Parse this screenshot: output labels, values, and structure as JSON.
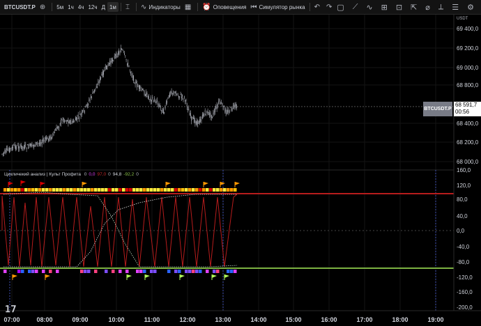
{
  "toolbar": {
    "symbol": "BTCUSDT.P",
    "intervals": [
      "5м",
      "1ч",
      "4ч",
      "12ч",
      "Д",
      "1м"
    ],
    "active_interval": "1м",
    "indicators_label": "Индикаторы",
    "alerts_label": "Оповещения",
    "replay_label": "Симулятор рынка",
    "icons": [
      "add-icon",
      "compare-icon",
      "indicators-icon",
      "templates-icon",
      "alert-icon",
      "replay-icon",
      "undo-icon",
      "redo-icon"
    ],
    "right_icons": [
      "rectangle-icon",
      "trendline-icon",
      "chart-type-icon",
      "fit-icon",
      "zoom-icon",
      "measure-icon",
      "brush-icon",
      "text-icon",
      "fib-icon",
      "pattern-icon",
      "settings-icon"
    ]
  },
  "price_axis": {
    "currency": "USDT",
    "labels": [
      "69 400,0",
      "69 200,0",
      "69 000,0",
      "68 800,0",
      "68 400,0",
      "68 200,0",
      "68 000,0"
    ],
    "current_price": "68 591,7",
    "countdown": "00:56",
    "symbol_tag": "BTCUSDT.P"
  },
  "indicator": {
    "legend_title": "Цикличекий анализ | Культ Профита",
    "legend_values": [
      {
        "v": "0",
        "color": "#b2b5be"
      },
      {
        "v": "0,0",
        "color": "#e040fb"
      },
      {
        "v": "97,0",
        "color": "#c62828"
      },
      {
        "v": "0",
        "color": "#b2b5be"
      },
      {
        "v": "94,8",
        "color": "#d1d4dc"
      },
      {
        "v": "-92,2",
        "color": "#8bc34a"
      },
      {
        "v": "0",
        "color": "#b2b5be"
      }
    ],
    "axis_labels": [
      "160,0",
      "120,0",
      "80,0",
      "40,0",
      "0,0",
      "-40,0",
      "-80,0",
      "-120,0",
      "-160,0",
      "-200,0"
    ]
  },
  "time_axis": [
    "07:00",
    "08:00",
    "09:00",
    "10:00",
    "11:00",
    "12:00",
    "13:00",
    "14:00",
    "15:00",
    "16:00",
    "17:00",
    "18:00",
    "19:00"
  ],
  "colors": {
    "background": "#000000",
    "candles": "#b2b5be",
    "upper_band": "#b71c1c",
    "lower_band": "#7cb342",
    "oscillator": "#b71c1c",
    "signal": "#c8e6c9",
    "session": "#3f51b5"
  }
}
